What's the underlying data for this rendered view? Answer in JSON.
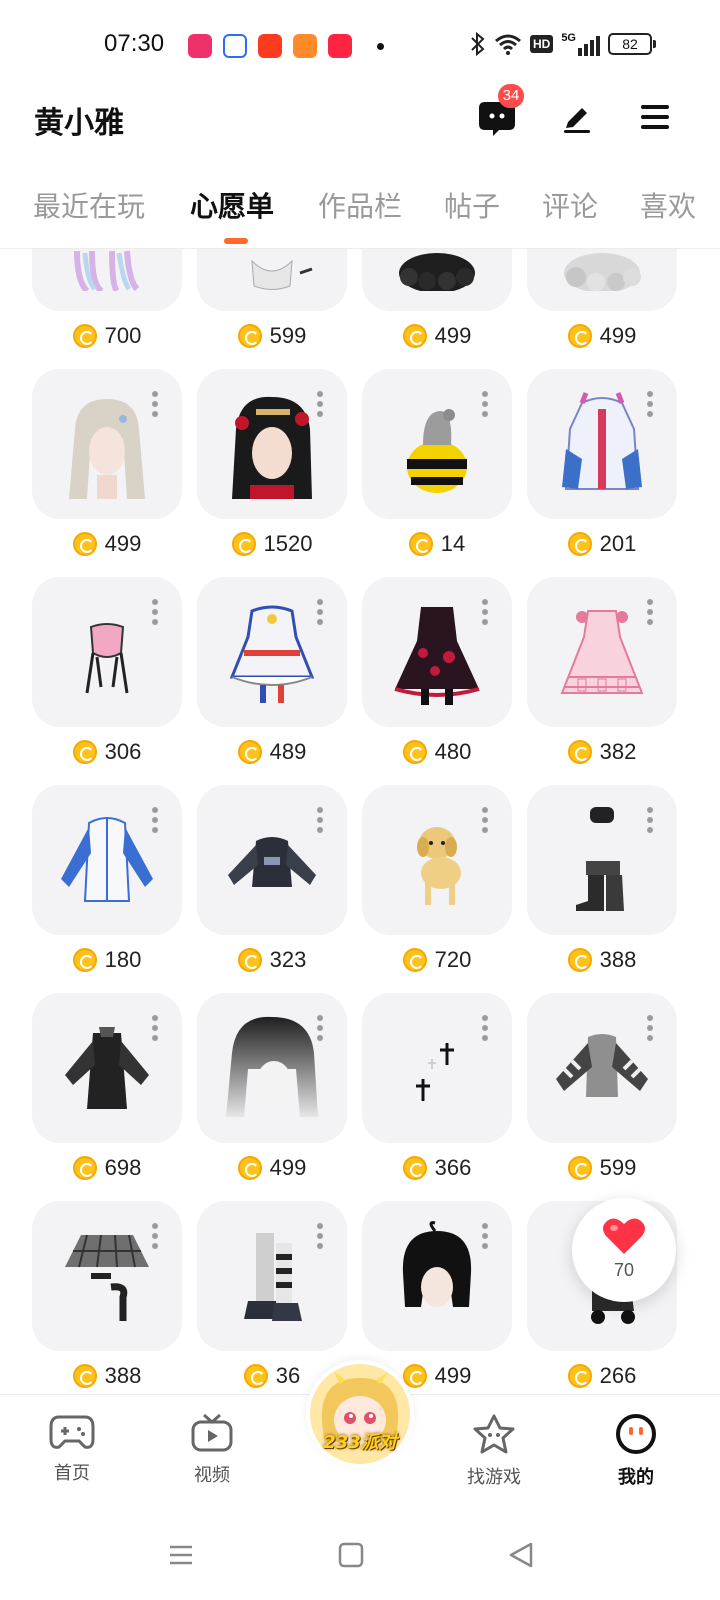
{
  "status_bar": {
    "time": "07:30",
    "battery": "82",
    "network": "5G",
    "hd": "HD"
  },
  "header": {
    "username": "黄小雅",
    "message_badge": "34"
  },
  "tabs": [
    {
      "label": "最近在玩",
      "active": false
    },
    {
      "label": "心愿单",
      "active": true
    },
    {
      "label": "作品栏",
      "active": false
    },
    {
      "label": "帖子",
      "active": false
    },
    {
      "label": "评论",
      "active": false
    },
    {
      "label": "喜欢",
      "active": false
    }
  ],
  "items": [
    {
      "price": "700",
      "icon": "pastel-hair-item"
    },
    {
      "price": "599",
      "icon": "white-dress-item"
    },
    {
      "price": "499",
      "icon": "black-curly-hair-item"
    },
    {
      "price": "499",
      "icon": "silver-curly-hair-item"
    },
    {
      "price": "499",
      "icon": "silver-twintail-hair-item"
    },
    {
      "price": "1520",
      "icon": "black-hair-red-ornaments-item"
    },
    {
      "price": "14",
      "icon": "bee-costume-item"
    },
    {
      "price": "201",
      "icon": "colorful-jacket-item"
    },
    {
      "price": "306",
      "icon": "pink-top-item"
    },
    {
      "price": "489",
      "icon": "idol-dress-item"
    },
    {
      "price": "480",
      "icon": "gothic-red-dress-item"
    },
    {
      "price": "382",
      "icon": "pink-lolita-dress-item"
    },
    {
      "price": "180",
      "icon": "blue-white-jacket-item"
    },
    {
      "price": "323",
      "icon": "dark-jacket-item"
    },
    {
      "price": "720",
      "icon": "yellow-puppy-item"
    },
    {
      "price": "388",
      "icon": "black-boots-hat-item"
    },
    {
      "price": "698",
      "icon": "black-outfit-item"
    },
    {
      "price": "499",
      "icon": "grey-gradient-hair-item"
    },
    {
      "price": "366",
      "icon": "cross-accessories-item"
    },
    {
      "price": "599",
      "icon": "striped-sleeves-top-item"
    },
    {
      "price": "388",
      "icon": "plaid-skirt-item"
    },
    {
      "price": "36",
      "icon": "striped-socks-shoes-item"
    },
    {
      "price": "499",
      "icon": "black-bob-hair-item"
    },
    {
      "price": "266",
      "icon": "black-skates-item"
    }
  ],
  "like": {
    "count": "70"
  },
  "bottom_nav": [
    {
      "label": "首页",
      "icon": "gamepad-icon",
      "active": false
    },
    {
      "label": "视频",
      "icon": "tv-play-icon",
      "active": false
    },
    {
      "label": "233派对",
      "icon": "party-avatar-icon",
      "active": false
    },
    {
      "label": "找游戏",
      "icon": "star-face-icon",
      "active": false
    },
    {
      "label": "我的",
      "icon": "profile-face-icon",
      "active": true
    }
  ],
  "colors": {
    "accent": "#ff6a2c",
    "coin": "#ffc21a",
    "badge": "#ff4b4b",
    "card_bg": "#f3f3f5"
  }
}
